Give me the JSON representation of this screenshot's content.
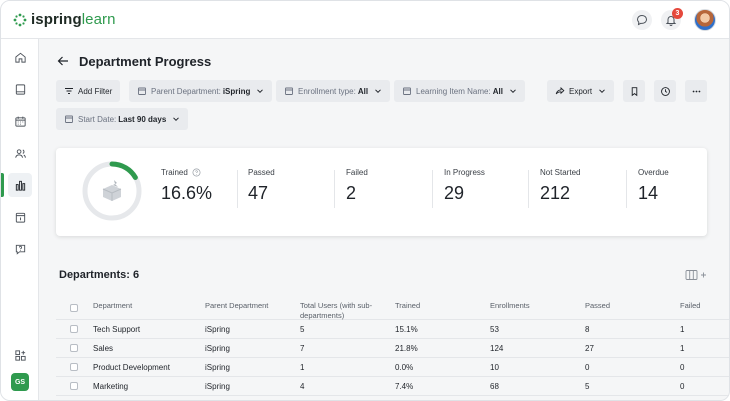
{
  "app": {
    "logo_word_a": "ispring",
    "logo_word_b": "learn",
    "notification_count": "3",
    "user_initials": "GS",
    "brand_color": "#2f9a4e"
  },
  "page": {
    "title": "Department Progress"
  },
  "filters": {
    "add_filter": "Add Filter",
    "parent_department_label": "Parent Department:",
    "parent_department_value": "iSpring",
    "enrollment_type_label": "Enrollment type:",
    "enrollment_type_value": "All",
    "learning_item_label": "Learning Item Name:",
    "learning_item_value": "All",
    "start_date_label": "Start Date:",
    "start_date_value": "Last 90 days",
    "export": "Export"
  },
  "stats": {
    "trained_label": "Trained",
    "trained_value": "16.6%",
    "trained_fraction": 0.166,
    "passed_label": "Passed",
    "passed_value": "47",
    "failed_label": "Failed",
    "failed_value": "2",
    "in_progress_label": "In Progress",
    "in_progress_value": "29",
    "not_started_label": "Not Started",
    "not_started_value": "212",
    "overdue_label": "Overdue",
    "overdue_value": "14"
  },
  "table": {
    "title": "Departments: 6",
    "headers": {
      "department": "Department",
      "parent": "Parent Department",
      "total_users": "Total Users (with sub-departments)",
      "trained": "Trained",
      "enrollments": "Enrollments",
      "passed": "Passed",
      "failed": "Failed"
    },
    "rows": [
      {
        "department": "Tech Support",
        "parent": "iSpring",
        "total_users": "5",
        "trained": "15.1%",
        "enrollments": "53",
        "passed": "8",
        "failed": "1"
      },
      {
        "department": "Sales",
        "parent": "iSpring",
        "total_users": "7",
        "trained": "21.8%",
        "enrollments": "124",
        "passed": "27",
        "failed": "1"
      },
      {
        "department": "Product Development",
        "parent": "iSpring",
        "total_users": "1",
        "trained": "0.0%",
        "enrollments": "10",
        "passed": "0",
        "failed": "0"
      },
      {
        "department": "Marketing",
        "parent": "iSpring",
        "total_users": "4",
        "trained": "7.4%",
        "enrollments": "68",
        "passed": "5",
        "failed": "0"
      }
    ]
  }
}
